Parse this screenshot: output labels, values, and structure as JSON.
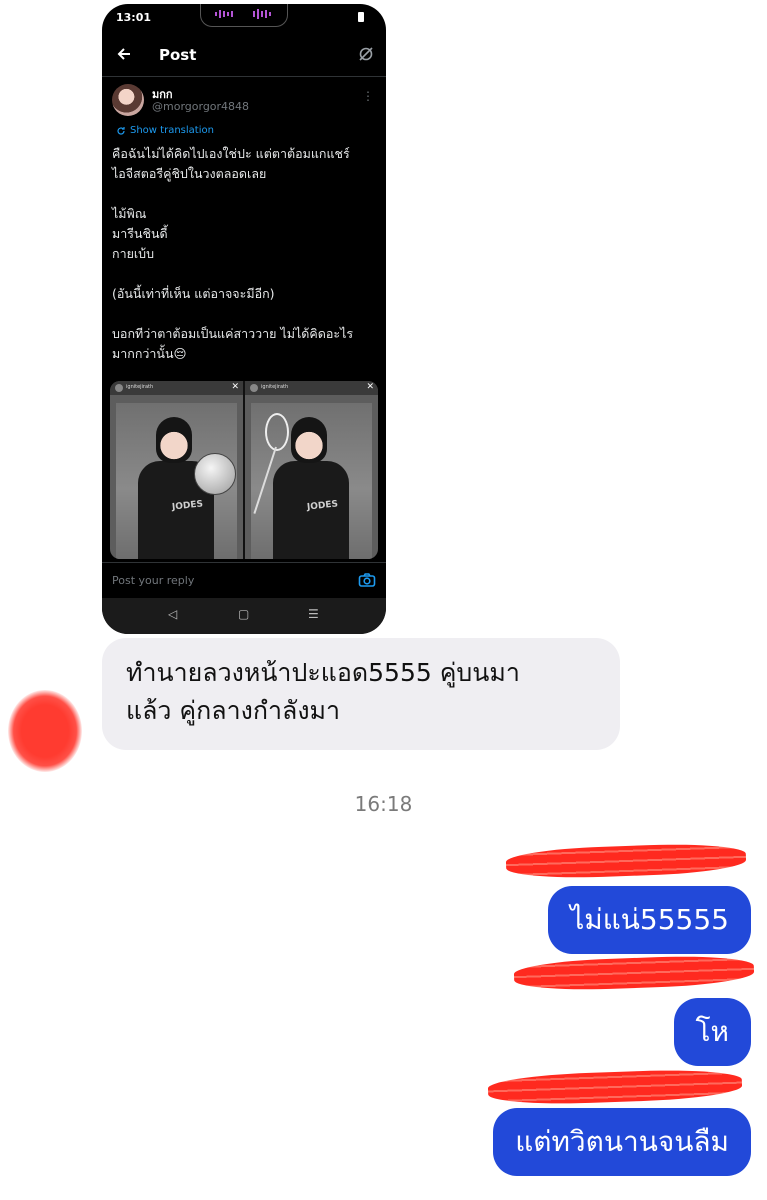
{
  "shared_post": {
    "status_time": "13:01",
    "nav_title": "Post",
    "author": {
      "display_name": "มกก",
      "handle": "@morgorgor4848"
    },
    "translation_label": "Show translation",
    "text": "คือฉันไม่ได้คิดไปเองใช่ปะ แต่ตาต้อมแกแชร์\nไอจีสตอรีคู่ชิปในวงตลอดเลย\n\nไม้พิณ\nมารีนชินดี้\nกายเบ้บ\n\n(อันนี้เท่าที่เห็น แต่อาจจะมีอีก)\n\nบอกทีว่าตาต้อมเป็นแค่สาววาย ไม่ได้คิดอะไร\nมากกว่านั้น😔",
    "media": {
      "story_account": "ignitejirath",
      "story_time": "8 ชม.",
      "jersey_text": "JODES"
    },
    "reply_placeholder": "Post your reply",
    "system_nav": [
      "◁",
      "▢",
      "☰"
    ]
  },
  "chat": {
    "incoming_message": "ทำนายลวงหน้าปะแอด5555 คู่บนมา\nแล้ว คู่กลางกำลังมา",
    "timestamp": "16:18",
    "outgoing_messages": [
      "ไม่แน่55555",
      "โห",
      "แต่ทวิตนานจนลืม"
    ]
  },
  "colors": {
    "outgoing_bubble": "#2249d9",
    "incoming_bubble": "#efeef2",
    "link_blue": "#1d9bf0",
    "redaction_red": "#ff2a1f"
  }
}
